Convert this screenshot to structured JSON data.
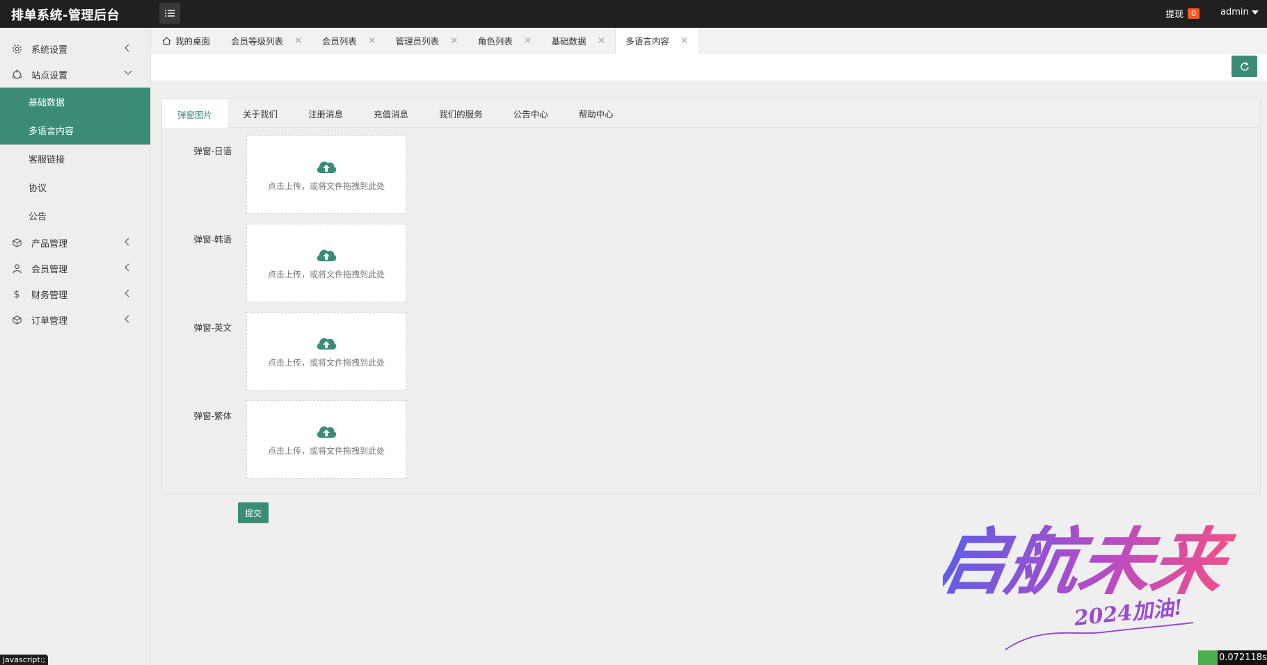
{
  "header": {
    "title": "排单系统-管理后台",
    "withdraw_label": "提现",
    "withdraw_count": "0",
    "user": "admin"
  },
  "sidebar": {
    "items": [
      {
        "label": "系统设置"
      },
      {
        "label": "站点设置"
      },
      {
        "label": "产品管理"
      },
      {
        "label": "会员管理"
      },
      {
        "label": "财务管理"
      },
      {
        "label": "订单管理"
      }
    ],
    "sub_items": [
      {
        "label": "基础数据"
      },
      {
        "label": "多语言内容"
      },
      {
        "label": "客服链接"
      },
      {
        "label": "协议"
      },
      {
        "label": "公告"
      }
    ]
  },
  "page_tabs": [
    {
      "label": "我的桌面"
    },
    {
      "label": "会员等级列表"
    },
    {
      "label": "会员列表"
    },
    {
      "label": "管理员列表"
    },
    {
      "label": "角色列表"
    },
    {
      "label": "基础数据"
    },
    {
      "label": "多语言内容"
    }
  ],
  "content_tabs": [
    {
      "label": "弹窗图片"
    },
    {
      "label": "关于我们"
    },
    {
      "label": "注册消息"
    },
    {
      "label": "充值消息"
    },
    {
      "label": "我们的服务"
    },
    {
      "label": "公告中心"
    },
    {
      "label": "帮助中心"
    }
  ],
  "upload_fields": [
    {
      "label": "弹窗-日语",
      "hint": "点击上传，或将文件拖拽到此处"
    },
    {
      "label": "弹窗-韩语",
      "hint": "点击上传，或将文件拖拽到此处"
    },
    {
      "label": "弹窗-英文",
      "hint": "点击上传，或将文件拖拽到此处"
    },
    {
      "label": "弹窗-繁体",
      "hint": "点击上传，或将文件拖拽到此处"
    }
  ],
  "submit_label": "提交",
  "status_bar": "javascript:;",
  "timer": "0.072118s",
  "watermark": {
    "main": "启航未来",
    "sub": "2024加油!"
  },
  "colors": {
    "accent": "#3b8c77",
    "topbar": "#202020",
    "badge": "#ff5722"
  }
}
